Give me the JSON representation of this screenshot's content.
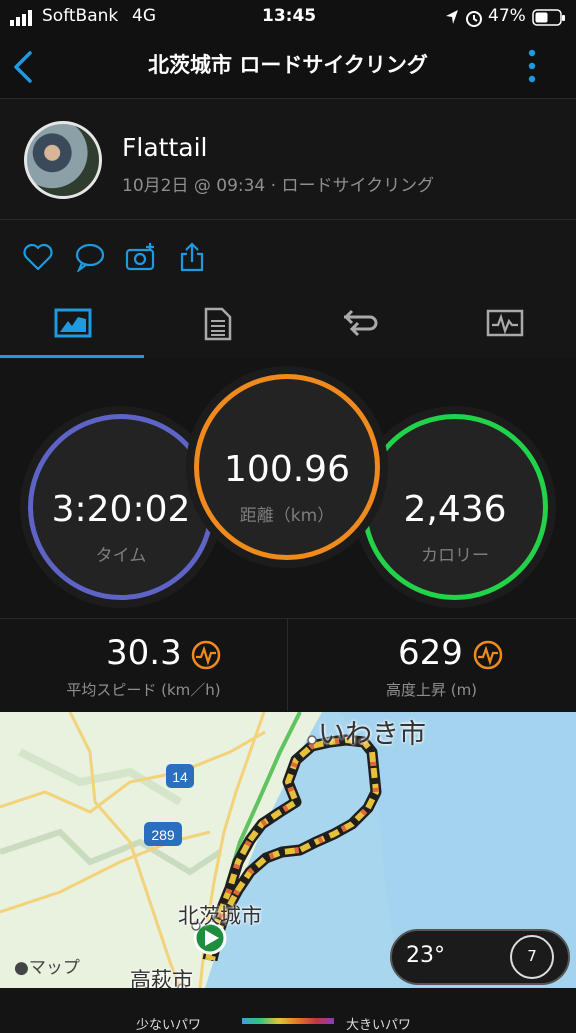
{
  "status": {
    "carrier": "SoftBank",
    "network": "4G",
    "time": "13:45",
    "battery": "47%"
  },
  "nav": {
    "title": "北茨城市 ロードサイクリング"
  },
  "profile": {
    "name": "Flattail",
    "meta": "10月2日 @ 09:34 · ロードサイクリング"
  },
  "stats": {
    "time": {
      "value": "3:20:02",
      "label": "タイム",
      "color": "#7b6fd0"
    },
    "distance": {
      "value": "100.96",
      "label": "距離（km）",
      "color": "#f08a1c"
    },
    "calories": {
      "value": "2,436",
      "label": "カロリー",
      "color": "#22d34a"
    },
    "avg_speed": {
      "value": "30.3",
      "label": "平均スピード (km／h)"
    },
    "elevation": {
      "value": "629",
      "label": "高度上昇 (m)"
    }
  },
  "map": {
    "city_iwaki": "いわき市",
    "city_kitaibaraki": "北茨城市",
    "city_takahagi": "高萩市",
    "route_14": "14",
    "route_289": "289",
    "attribution": "マップ",
    "temperature": "23°",
    "wind": "7"
  },
  "legend": {
    "slow": "少ないパワ",
    "fast": "大きいパワ"
  }
}
